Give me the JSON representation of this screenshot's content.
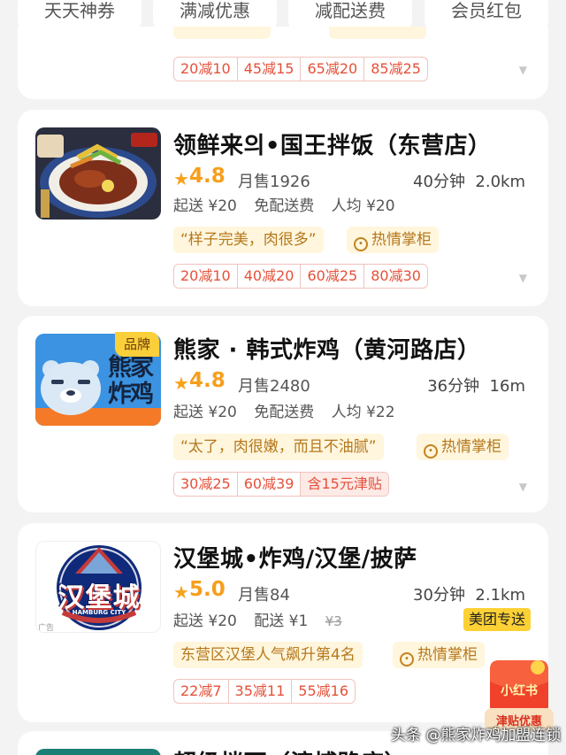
{
  "filters": [
    "天天神券",
    "满减优惠",
    "减配送费",
    "会员红包"
  ],
  "stores": [
    {
      "discounts": [
        "20减10",
        "45减15",
        "65减20",
        "85减25"
      ]
    },
    {
      "name": "领鲜来의•国王拌饭（东营店）",
      "rating": "4.8",
      "monthly_sales": "月售1926",
      "delivery_time": "40分钟",
      "distance": "2.0km",
      "min_order": "起送 ¥20",
      "delivery_fee": "免配送费",
      "per_person": "人均 ¥20",
      "review_tag": "“样子完美，肉很多”",
      "hot_tag": "热情掌柜",
      "discounts": [
        "20减10",
        "40减20",
        "60减25",
        "80减30"
      ]
    },
    {
      "name": "熊家 · 韩式炸鸡（黄河路店）",
      "badge": "品牌",
      "logo_text": "熊家炸鸡",
      "rating": "4.8",
      "monthly_sales": "月售2480",
      "delivery_time": "36分钟",
      "distance": "16m",
      "min_order": "起送 ¥20",
      "delivery_fee": "免配送费",
      "per_person": "人均 ¥22",
      "review_tag": "“太了，肉很嫩，而且不油腻”",
      "hot_tag": "热情掌柜",
      "discounts": [
        "30减25",
        "60减39",
        "含15元津贴"
      ]
    },
    {
      "name": "汉堡城•炸鸡/汉堡/披萨",
      "logo_text": "汉堡城",
      "logo_sub": "HAMBURG CITY",
      "ad_label": "广告",
      "rating": "5.0",
      "monthly_sales": "月售84",
      "delivery_time": "30分钟",
      "distance": "2.1km",
      "min_order": "起送 ¥20",
      "delivery_fee": "配送 ¥1",
      "original_fee": "¥3",
      "meituan_badge": "美团专送",
      "rank_tag": "东营区汉堡人气飙升第4名",
      "hot_tag": "热情掌柜",
      "discounts": [
        "22减7",
        "35减11",
        "55减16"
      ]
    },
    {
      "name": "超级拌面（滨博路店）"
    }
  ],
  "floating": {
    "envelope_top": "小红书",
    "envelope_bottom": "津贴优惠"
  },
  "watermark": "头条 @熊家炸鸡加盟连锁",
  "colors": {
    "accent_orange": "#f79e1b",
    "discount_red": "#e5503a",
    "chip_bg": "#fff6dd",
    "meituan_yellow": "#fdd135"
  }
}
